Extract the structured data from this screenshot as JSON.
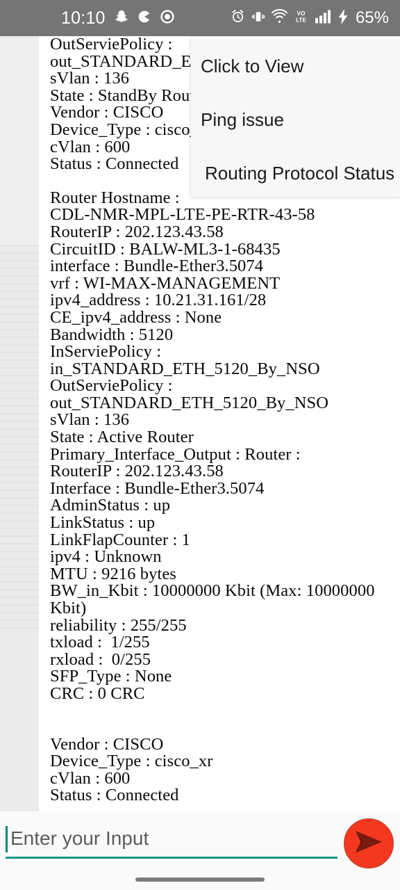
{
  "statusbar": {
    "clock": "10:10",
    "battery": "65%",
    "app_icons": [
      "snapchat-icon",
      "pacman-circle-icon",
      "camera-ring-icon"
    ],
    "system_icons": [
      "alarm-icon",
      "vibrate-icon",
      "wifi-icon",
      "volte-icon",
      "signal-bars-icon",
      "charging-bolt-icon"
    ],
    "bg_color": "#757575"
  },
  "popup_menu": {
    "items": [
      {
        "label": "Click to View"
      },
      {
        "label": "Ping issue"
      },
      {
        "label": "Routing Protocol Status"
      }
    ],
    "bg_color": "#f7f7f7"
  },
  "message": {
    "text_block_1": "OutServiePolicy :\nout_STANDARD_E\nsVlan : 136\nState : StandBy Rout\nVendor : CISCO\nDevice_Type : cisco_\ncVlan : 600\nStatus : Connected",
    "text_block_2": "Router Hostname :\nCDL-NMR-MPL-LTE-PE-RTR-43-58\nRouterIP : 202.123.43.58\nCircuitID : BALW-ML3-1-68435\ninterface : Bundle-Ether3.5074\nvrf : WI-MAX-MANAGEMENT\nipv4_address : 10.21.31.161/28\nCE_ipv4_address : None\nBandwidth : 5120\nInServiePolicy :\nin_STANDARD_ETH_5120_By_NSO\nOutServiePolicy :\nout_STANDARD_ETH_5120_By_NSO\nsVlan : 136\nState : Active Router\nPrimary_Interface_Output : Router :\nRouterIP : 202.123.43.58\nInterface : Bundle-Ether3.5074\nAdminStatus : up\nLinkStatus : up\nLinkFlapCounter : 1\nipv4 : Unknown\nMTU : 9216 bytes\nBW_in_Kbit : 10000000 Kbit (Max: 10000000\nKbit)\nreliability : 255/255\ntxload :  1/255\nrxload :  0/255\nSFP_Type : None\nCRC : 0 CRC",
    "text_block_3": "Vendor : CISCO\nDevice_Type : cisco_xr\ncVlan : 600\nStatus : Connected",
    "bubble_color": "#ffffff"
  },
  "input": {
    "value": "",
    "placeholder": "Enter your Input",
    "underline_color": "#0b9c86",
    "caret_color": "#00897b"
  },
  "send_button": {
    "icon": "send-paper-plane-icon",
    "bg_color": "#f4381f",
    "glyph_color": "#7b1a10"
  },
  "navbar": {
    "pill_color": "#7c7c7c"
  }
}
